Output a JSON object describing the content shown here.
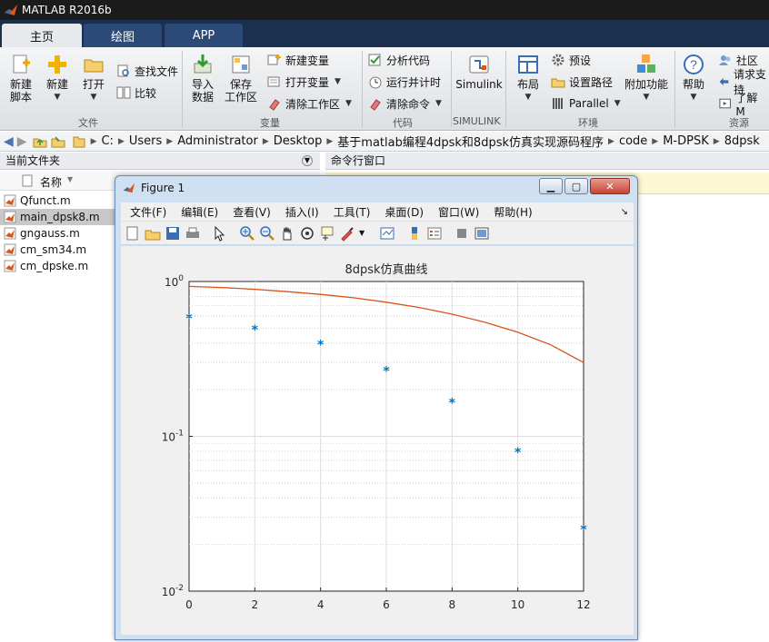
{
  "app": {
    "title": "MATLAB R2016b"
  },
  "tabs": [
    {
      "label": "主页",
      "active": true
    },
    {
      "label": "绘图",
      "active": false
    },
    {
      "label": "APP",
      "active": false
    }
  ],
  "ribbon": {
    "new_script": [
      "新建",
      "脚本"
    ],
    "new": "新建",
    "open": "打开",
    "find_files": "查找文件",
    "compare": "比较",
    "import": [
      "导入",
      "数据"
    ],
    "save_workspace": [
      "保存",
      "工作区"
    ],
    "new_variable": "新建变量",
    "open_variable": "打开变量",
    "clear_workspace": "清除工作区",
    "analyze_code": "分析代码",
    "run_and_time": "运行并计时",
    "clear_commands": "清除命令",
    "simulink": "Simulink",
    "layout": "布局",
    "preferences": "预设",
    "set_path": "设置路径",
    "parallel": "Parallel",
    "addons": "附加功能",
    "help": "帮助",
    "community": "社区",
    "request_support": "请求支持",
    "learn": "了解 M",
    "groups": [
      "文件",
      "变量",
      "代码",
      "SIMULINK",
      "环境",
      "资源"
    ]
  },
  "address": {
    "crumbs": [
      "C:",
      "Users",
      "Administrator",
      "Desktop",
      "基于matlab编程4dpsk和8dpsk仿真实现源码程序",
      "code",
      "M-DPSK",
      "8dpsk"
    ]
  },
  "current_folder": {
    "title": "当前文件夹",
    "column": "名称",
    "files": [
      "Qfunct.m",
      "main_dpsk8.m",
      "gngauss.m",
      "cm_sm34.m",
      "cm_dpske.m"
    ],
    "selected_index": 1
  },
  "command_window": {
    "title": "命令行窗口"
  },
  "figure": {
    "title": "Figure 1",
    "menu": [
      "文件(F)",
      "编辑(E)",
      "查看(V)",
      "插入(I)",
      "工具(T)",
      "桌面(D)",
      "窗口(W)",
      "帮助(H)"
    ],
    "window_buttons": [
      "minimize",
      "maximize",
      "close"
    ]
  },
  "chart_data": {
    "type": "scatter",
    "title": "8dpsk仿真曲线",
    "xlabel": "",
    "ylabel": "",
    "xlim": [
      0,
      12
    ],
    "ylim": [
      0.01,
      1
    ],
    "y_scale": "log",
    "grid": true,
    "x_ticks": [
      "0",
      "2",
      "4",
      "6",
      "8",
      "10",
      "12"
    ],
    "y_ticks": [
      {
        "value": 1,
        "base": "10",
        "exp": "0"
      },
      {
        "value": 0.1,
        "base": "10",
        "exp": "-1"
      },
      {
        "value": 0.01,
        "base": "10",
        "exp": "-2"
      }
    ],
    "series": [
      {
        "style": "markers",
        "marker": "*",
        "color": "#0072bd",
        "x": [
          0,
          2,
          4,
          6,
          8,
          10,
          12
        ],
        "y": [
          0.58,
          0.49,
          0.39,
          0.265,
          0.165,
          0.079,
          0.025
        ]
      },
      {
        "style": "line",
        "color": "#d95319",
        "x": [
          0,
          1,
          2,
          3,
          4,
          5,
          6,
          7,
          8,
          9,
          10,
          11,
          12
        ],
        "y": [
          0.93,
          0.915,
          0.89,
          0.86,
          0.825,
          0.785,
          0.735,
          0.68,
          0.615,
          0.545,
          0.47,
          0.39,
          0.3
        ]
      }
    ]
  }
}
